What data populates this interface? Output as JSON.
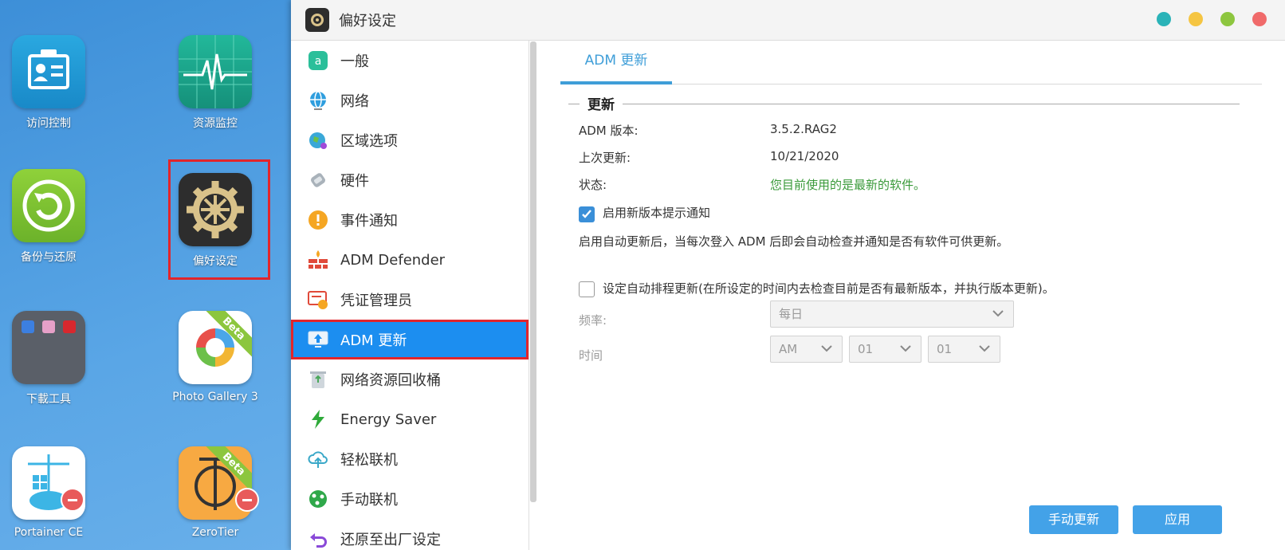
{
  "desktop": {
    "icons": [
      {
        "label": "访问控制"
      },
      {
        "label": "资源监控"
      },
      {
        "label": "备份与还原"
      },
      {
        "label": "偏好设定"
      },
      {
        "label": "下載工具"
      },
      {
        "label": "Photo Gallery 3",
        "badge": "Beta"
      },
      {
        "label": "Portainer CE"
      },
      {
        "label": "ZeroTier",
        "badge": "Beta"
      }
    ]
  },
  "window": {
    "title": "偏好设定",
    "controls": [
      "minimize",
      "restore",
      "maximize",
      "close"
    ]
  },
  "sidebar": {
    "items": [
      {
        "label": "一般",
        "icon": "general-icon"
      },
      {
        "label": "网络",
        "icon": "globe-icon"
      },
      {
        "label": "区域选项",
        "icon": "region-icon"
      },
      {
        "label": "硬件",
        "icon": "hardware-icon"
      },
      {
        "label": "事件通知",
        "icon": "alert-icon"
      },
      {
        "label": "ADM Defender",
        "icon": "firewall-icon"
      },
      {
        "label": "凭证管理员",
        "icon": "certificate-icon"
      },
      {
        "label": "ADM 更新",
        "icon": "update-icon",
        "selected": true
      },
      {
        "label": "网络资源回收桶",
        "icon": "recycle-bin-icon"
      },
      {
        "label": "Energy Saver",
        "icon": "energy-icon"
      },
      {
        "label": "轻松联机",
        "icon": "cloud-connect-icon"
      },
      {
        "label": "手动联机",
        "icon": "network-icon"
      },
      {
        "label": "还原至出厂设定",
        "icon": "restore-icon"
      }
    ]
  },
  "main": {
    "tab": "ADM 更新",
    "section_title": "更新",
    "adm_version_label": "ADM 版本:",
    "adm_version": "3.5.2.RAG2",
    "last_update_label": "上次更新:",
    "last_update": "10/21/2020",
    "status_label": "状态:",
    "status": "您目前使用的是最新的软件。",
    "notify_checkbox_label": "启用新版本提示通知",
    "notify_checked": true,
    "notify_description": "启用自动更新后，当每次登入 ADM 后即会自动检查并通知是否有软件可供更新。",
    "schedule_checkbox_label": "设定自动排程更新(在所设定的时间内去检查目前是否有最新版本，并执行版本更新)。",
    "schedule_checked": false,
    "frequency_label": "频率:",
    "frequency_value": "每日",
    "time_label": "时间",
    "time_ampm": "AM",
    "time_hour": "01",
    "time_minute": "01",
    "manual_update_button": "手动更新",
    "apply_button": "应用"
  },
  "colors": {
    "accent": "#1c8ef0",
    "highlight": "#e2252b",
    "status_ok": "#3a9a3a",
    "tab": "#3f9ed8",
    "button": "#43a2e8"
  }
}
